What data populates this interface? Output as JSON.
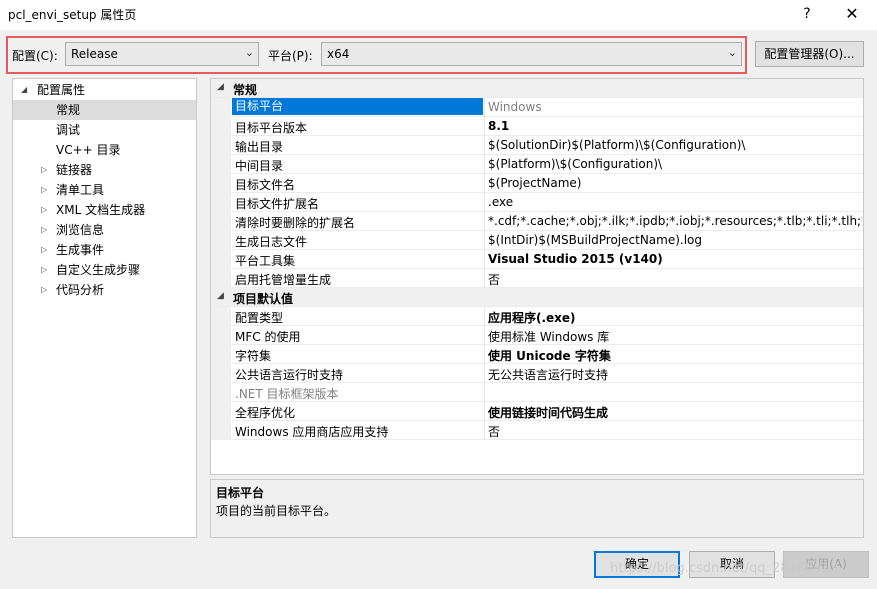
{
  "window": {
    "title": "pcl_envi_setup 属性页",
    "help_glyph": "?",
    "close_glyph": "✕"
  },
  "config": {
    "config_label": "配置(C):",
    "config_value": "Release",
    "platform_label": "平台(P):",
    "platform_value": "x64",
    "manager_button": "配置管理器(O)...",
    "highlight_color": "#e35c5c"
  },
  "tree": {
    "root": "配置属性",
    "items": [
      {
        "label": "常规",
        "selected": true,
        "expandable": false
      },
      {
        "label": "调试",
        "expandable": false
      },
      {
        "label": "VC++ 目录",
        "expandable": false
      },
      {
        "label": "链接器",
        "expandable": true
      },
      {
        "label": "清单工具",
        "expandable": true
      },
      {
        "label": "XML 文档生成器",
        "expandable": true
      },
      {
        "label": "浏览信息",
        "expandable": true
      },
      {
        "label": "生成事件",
        "expandable": true
      },
      {
        "label": "自定义生成步骤",
        "expandable": true
      },
      {
        "label": "代码分析",
        "expandable": true
      }
    ]
  },
  "grid": {
    "sections": [
      {
        "title": "常规",
        "rows": [
          {
            "name": "目标平台",
            "value": "Windows",
            "selected": true,
            "value_gray": true
          },
          {
            "name": "目标平台版本",
            "value": "8.1",
            "bold": true
          },
          {
            "name": "输出目录",
            "value": "$(SolutionDir)$(Platform)\\$(Configuration)\\"
          },
          {
            "name": "中间目录",
            "value": "$(Platform)\\$(Configuration)\\"
          },
          {
            "name": "目标文件名",
            "value": "$(ProjectName)"
          },
          {
            "name": "目标文件扩展名",
            "value": ".exe"
          },
          {
            "name": "清除时要删除的扩展名",
            "value": "*.cdf;*.cache;*.obj;*.ilk;*.ipdb;*.iobj;*.resources;*.tlb;*.tli;*.tlh;*.tmp;*"
          },
          {
            "name": "生成日志文件",
            "value": "$(IntDir)$(MSBuildProjectName).log"
          },
          {
            "name": "平台工具集",
            "value": "Visual Studio 2015 (v140)",
            "bold": true
          },
          {
            "name": "启用托管增量生成",
            "value": "否"
          }
        ]
      },
      {
        "title": "项目默认值",
        "rows": [
          {
            "name": "配置类型",
            "value": "应用程序(.exe)",
            "bold": true
          },
          {
            "name": "MFC 的使用",
            "value": "使用标准 Windows 库"
          },
          {
            "name": "字符集",
            "value": "使用 Unicode 字符集",
            "bold": true
          },
          {
            "name": "公共语言运行时支持",
            "value": "无公共语言运行时支持"
          },
          {
            "name": ".NET 目标框架版本",
            "value": "",
            "name_gray": true
          },
          {
            "name": "全程序优化",
            "value": "使用链接时间代码生成",
            "bold": true
          },
          {
            "name": "Windows 应用商店应用支持",
            "value": "否"
          }
        ]
      }
    ]
  },
  "description": {
    "title": "目标平台",
    "text": "项目的当前目标平台。"
  },
  "buttons": {
    "ok": "确定",
    "cancel": "取消",
    "apply": "应用(A)"
  },
  "watermark": "https://blog.csdn.net/qq_28166413",
  "colors": {
    "selection": "#0078d7",
    "dialog_bg": "#f0f0f0"
  }
}
